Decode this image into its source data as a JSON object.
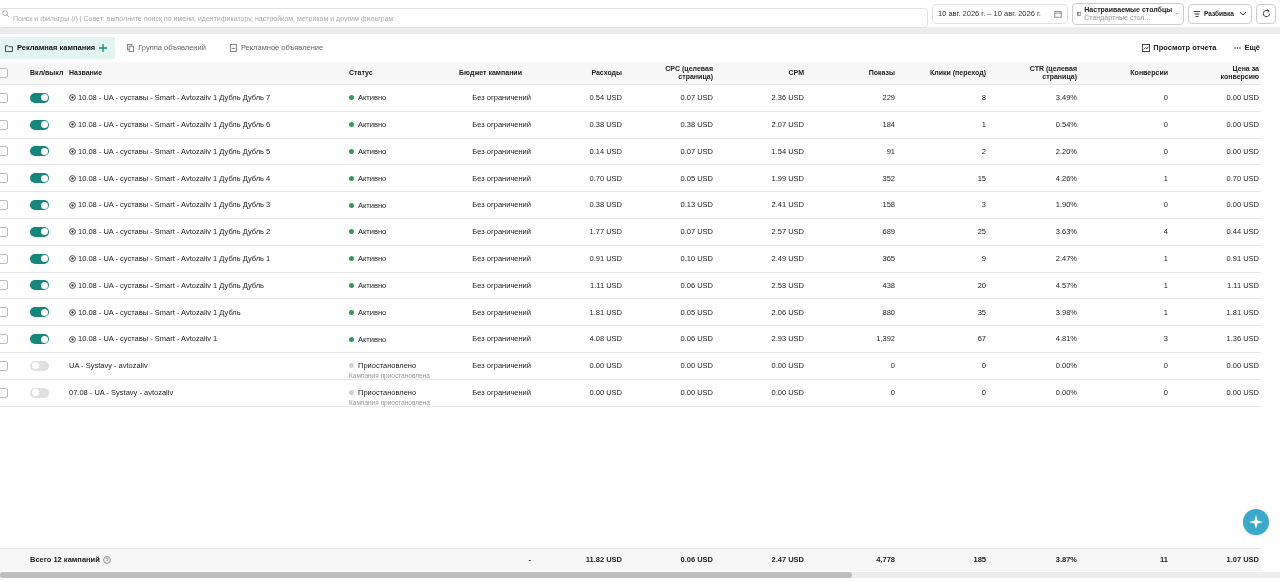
{
  "toolbar": {
    "search": {
      "placeholder": "Поиск и фильтры (/) | Совет: выполните поиск по имени, идентификатору, настройкам, метрикам и другим фильтрам"
    },
    "date_range": "10 авг. 2026 г. – 10 авг. 2026 г.",
    "columns_button": {
      "label": "Настраиваемые столбцы",
      "sublabel": "Стандартные стол..."
    },
    "breakdown_button": "Разбивка"
  },
  "tabs": [
    {
      "label": "Рекламная кампания",
      "selected": true
    },
    {
      "label": "Группа объявлений",
      "selected": false
    },
    {
      "label": "Рекламное объявление",
      "selected": false
    }
  ],
  "actions": [
    "Просмотр отчета",
    "Ещё"
  ],
  "table": {
    "columns": [
      "Вкл/выкл",
      "Название",
      "Статус",
      "Бюджет кампании",
      "Расходы",
      "CPC (целевая страница)",
      "CPM",
      "Показы",
      "Клики (переход)",
      "CTR (целевая страница)",
      "Конверсии",
      "Цена за конверсию"
    ],
    "all_checked": false,
    "rows": [
      {
        "checked": false,
        "on": true,
        "smart_icon": true,
        "name": "10.08 - UA - суставы - Smart - Avtozaliv 1 Дубль Дубль 7",
        "status": {
          "label": "Активно",
          "active": true
        },
        "budget": "Без ограничений",
        "values": [
          "0.54 USD",
          "0.07 USD",
          "2.36 USD",
          "229",
          "8",
          "3.49%",
          "0",
          "0.00 USD"
        ]
      },
      {
        "checked": false,
        "on": true,
        "smart_icon": true,
        "name": "10.08 - UA - суставы - Smart - Avtozaliv 1 Дубль Дубль 6",
        "status": {
          "label": "Активно",
          "active": true
        },
        "budget": "Без ограничений",
        "values": [
          "0.38 USD",
          "0.38 USD",
          "2.07 USD",
          "184",
          "1",
          "0.54%",
          "0",
          "0.00 USD"
        ]
      },
      {
        "checked": false,
        "on": true,
        "smart_icon": true,
        "name": "10.08 - UA - суставы - Smart - Avtozaliv 1 Дубль Дубль 5",
        "status": {
          "label": "Активно",
          "active": true
        },
        "budget": "Без ограничений",
        "values": [
          "0.14 USD",
          "0.07 USD",
          "1.54 USD",
          "91",
          "2",
          "2.20%",
          "0",
          "0.00 USD"
        ]
      },
      {
        "checked": false,
        "on": true,
        "smart_icon": true,
        "name": "10.08 - UA - суставы - Smart - Avtozaliv 1 Дубль Дубль 4",
        "status": {
          "label": "Активно",
          "active": true
        },
        "budget": "Без ограничений",
        "values": [
          "0.70 USD",
          "0.05 USD",
          "1.99 USD",
          "352",
          "15",
          "4.26%",
          "1",
          "0.70 USD"
        ]
      },
      {
        "checked": false,
        "on": true,
        "smart_icon": true,
        "name": "10.08 - UA - суставы - Smart - Avtozaliv 1 Дубль Дубль 3",
        "status": {
          "label": "Активно",
          "active": true
        },
        "budget": "Без ограничений",
        "values": [
          "0.38 USD",
          "0.13 USD",
          "2.41 USD",
          "158",
          "3",
          "1.90%",
          "0",
          "0.00 USD"
        ]
      },
      {
        "checked": false,
        "on": true,
        "smart_icon": true,
        "name": "10.08 - UA - суставы - Smart - Avtozaliv 1 Дубль Дубль 2",
        "status": {
          "label": "Активно",
          "active": true
        },
        "budget": "Без ограничений",
        "values": [
          "1.77 USD",
          "0.07 USD",
          "2.57 USD",
          "689",
          "25",
          "3.63%",
          "4",
          "0.44 USD"
        ]
      },
      {
        "checked": false,
        "on": true,
        "smart_icon": true,
        "name": "10.08 - UA - суставы - Smart - Avtozaliv 1 Дубль Дубль 1",
        "status": {
          "label": "Активно",
          "active": true
        },
        "budget": "Без ограничений",
        "values": [
          "0.91 USD",
          "0.10 USD",
          "2.49 USD",
          "365",
          "9",
          "2.47%",
          "1",
          "0.91 USD"
        ]
      },
      {
        "checked": false,
        "on": true,
        "smart_icon": true,
        "name": "10.08 - UA - суставы - Smart - Avtozaliv 1 Дубль Дубль",
        "status": {
          "label": "Активно",
          "active": true
        },
        "budget": "Без ограничений",
        "values": [
          "1.11 USD",
          "0.06 USD",
          "2.53 USD",
          "438",
          "20",
          "4.57%",
          "1",
          "1.11 USD"
        ]
      },
      {
        "checked": false,
        "on": true,
        "smart_icon": true,
        "name": "10.08 - UA - суставы - Smart - Avtozaliv 1 Дубль",
        "status": {
          "label": "Активно",
          "active": true
        },
        "budget": "Без ограничений",
        "values": [
          "1.81 USD",
          "0.05 USD",
          "2.06 USD",
          "880",
          "35",
          "3.98%",
          "1",
          "1.81 USD"
        ]
      },
      {
        "checked": false,
        "on": true,
        "smart_icon": true,
        "name": "10.08 - UA - суставы - Smart - Avtozaliv 1",
        "status": {
          "label": "Активно",
          "active": true
        },
        "budget": "Без ограничений",
        "values": [
          "4.08 USD",
          "0.06 USD",
          "2.93 USD",
          "1,392",
          "67",
          "4.81%",
          "3",
          "1.36 USD"
        ]
      },
      {
        "checked": false,
        "on": false,
        "smart_icon": false,
        "name": "UA - Systavy - avtozaliv",
        "status": {
          "label": "Приостановлено",
          "active": false,
          "note": "Кампания приостановлена"
        },
        "budget": "Без ограничений",
        "values": [
          "0.00 USD",
          "0.00 USD",
          "0.00 USD",
          "0",
          "0",
          "0.00%",
          "0",
          "0.00 USD"
        ]
      },
      {
        "checked": false,
        "on": false,
        "smart_icon": false,
        "name": "07.08 - UA - Systavy - avtozaliv",
        "status": {
          "label": "Приостановлено",
          "active": false,
          "note": "Кампания приостановлена"
        },
        "budget": "Без ограничений",
        "values": [
          "0.00 USD",
          "0.00 USD",
          "0.00 USD",
          "0",
          "0",
          "0.00%",
          "0",
          "0.00 USD"
        ]
      }
    ],
    "totals": {
      "label": "Всего 12 кампаний",
      "budget": "-",
      "values": [
        "11.82 USD",
        "0.06 USD",
        "2.47 USD",
        "4,778",
        "185",
        "3.87%",
        "11",
        "1.07 USD"
      ]
    }
  }
}
